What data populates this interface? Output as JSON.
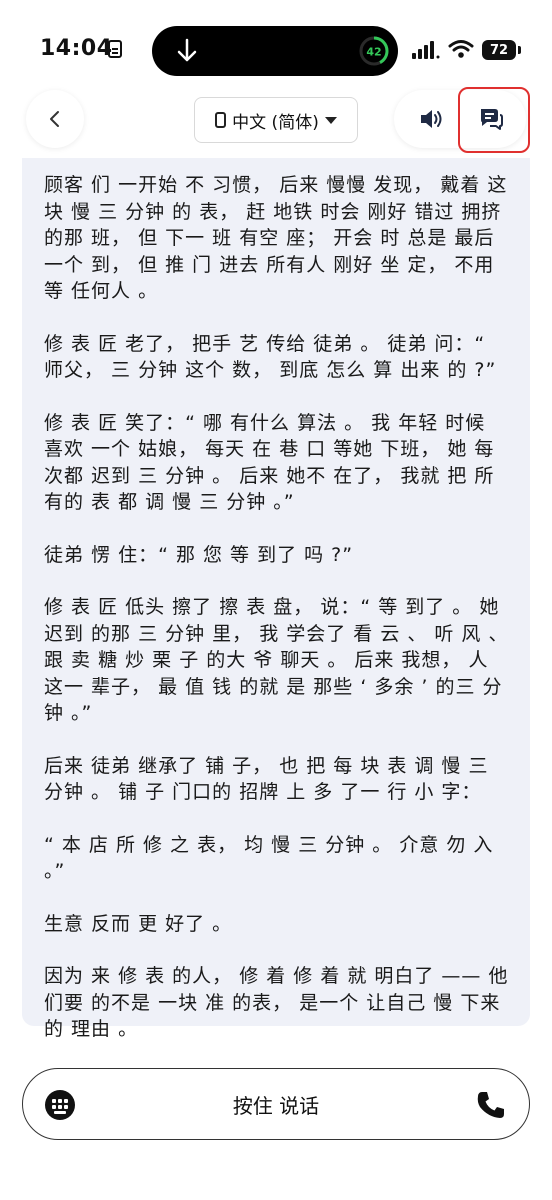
{
  "status_bar": {
    "time": "14:04",
    "battery_ring_value": "42",
    "battery_level": "72"
  },
  "header": {
    "language": "中文 (简体)"
  },
  "story": {
    "paragraphs": [
      "顾客 们 一开始 不 习惯， 后来 慢慢 发现， 戴着 这块 慢 三 分钟 的 表， 赶 地铁 时会 刚好 错过 拥挤 的那 班， 但 下一 班 有空 座； 开会 时 总是 最后一个 到， 但 推 门 进去 所有人 刚好 坐 定， 不用 等 任何人 。",
      "修 表 匠 老了， 把手 艺 传给 徒弟 。 徒弟 问：“ 师父， 三 分钟 这个 数， 到底 怎么 算 出来 的 ?”",
      "修 表 匠 笑了：“ 哪 有什么 算法 。 我 年轻 时候 喜欢 一个 姑娘， 每天 在 巷 口 等她 下班， 她 每次都 迟到 三 分钟 。 后来 她不 在了， 我就 把 所有的 表 都 调 慢 三 分钟 。”",
      "徒弟 愣 住：“ 那 您 等 到了 吗 ?”",
      "修 表 匠 低头 擦了 擦 表 盘， 说：“ 等 到了 。 她 迟到 的那 三 分钟 里， 我 学会了 看 云 、 听 风 、 跟 卖 糖 炒 栗 子 的大 爷 聊天 。 后来 我想， 人 这一 辈子， 最 值 钱 的就 是 那些 ‘ 多余 ’ 的三 分钟 。”",
      "后来 徒弟 继承了 铺 子， 也 把 每 块 表 调 慢 三 分钟 。 铺 子 门口的 招牌 上 多 了一 行 小 字：",
      "“ 本 店 所 修 之 表， 均 慢 三 分钟 。 介意 勿 入 。”",
      "生意 反而 更 好了 。",
      "因为 来 修 表 的人， 修 着 修 着 就 明白了 —— 他们要 的不是 一块 准 的表， 是一个 让自己 慢 下来 的 理由 。"
    ]
  },
  "input_bar": {
    "talk_label": "按住 说话"
  },
  "icons": {
    "back": "chevron-left-icon",
    "speaker": "speaker-icon",
    "chat": "chat-bubbles-icon",
    "keyboard": "keyboard-icon",
    "phone": "phone-icon"
  },
  "colors": {
    "card_background": "#eff1f8",
    "highlight_border": "#e0302f",
    "battery_ring": "#34c759"
  }
}
